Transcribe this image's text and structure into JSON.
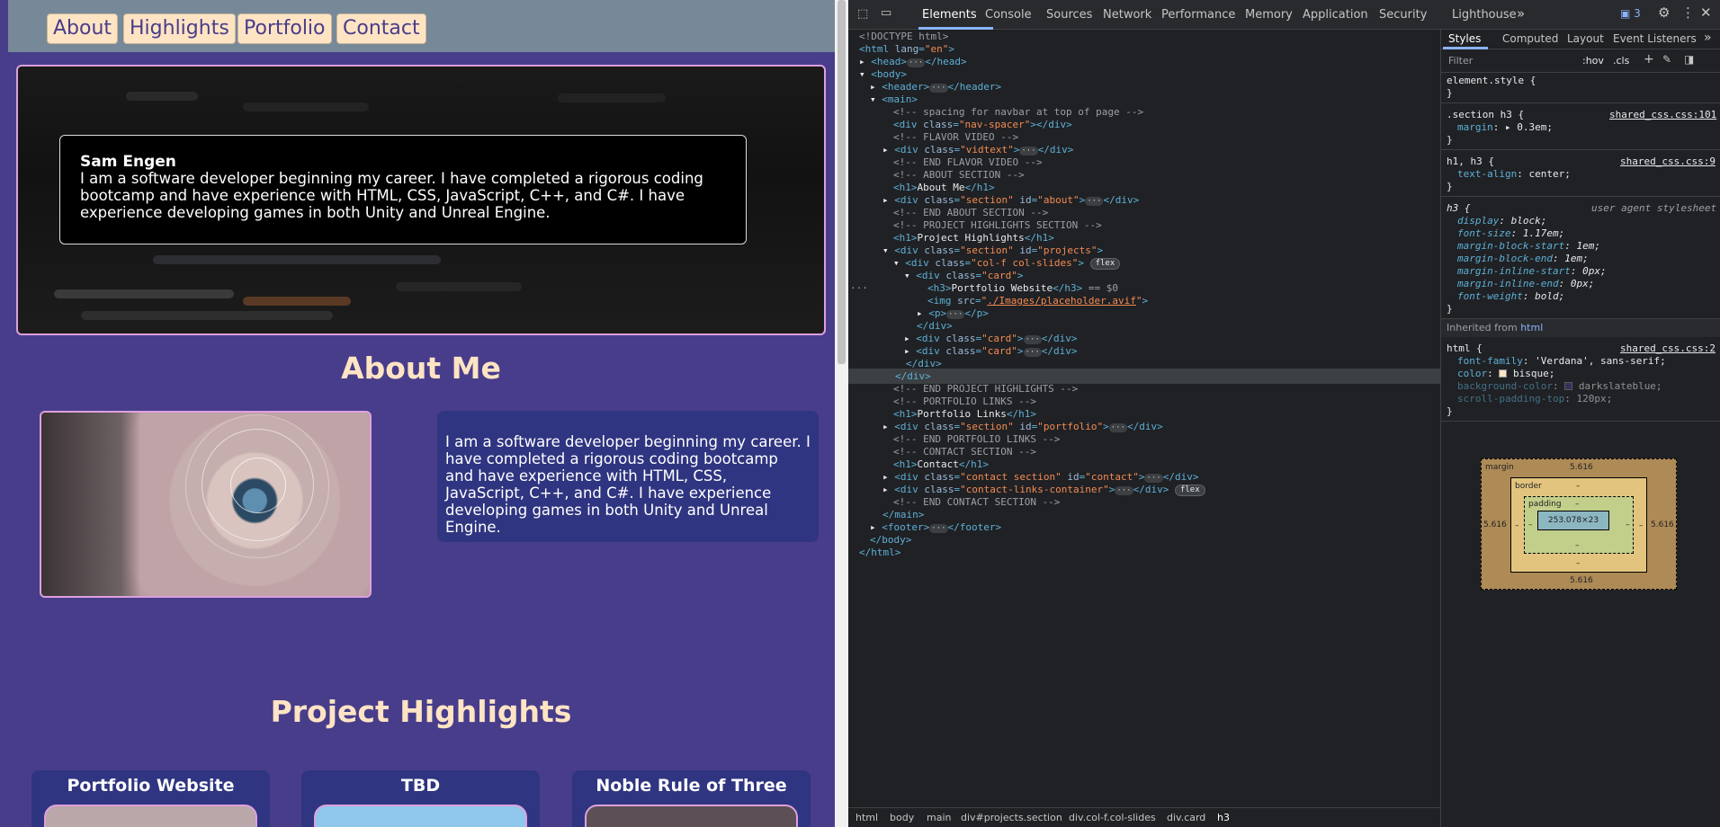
{
  "site": {
    "nav": [
      "About",
      "Highlights",
      "Portfolio",
      "Contact"
    ],
    "hero": {
      "name": "Sam Engen",
      "text": "I am a software developer beginning my career. I have completed a rigorous coding bootcamp and have experience with HTML, CSS, JavaScript, C++, and C#. I have experience developing games in both Unity and Unreal Engine."
    },
    "about_title": "About Me",
    "about_text": "I am a software developer beginning my career. I have completed a rigorous coding bootcamp and have experience with HTML, CSS, JavaScript, C++, and C#. I have experience developing games in both Unity and Unreal Engine.",
    "projects_title": "Project Highlights",
    "cards": [
      "Portfolio Website",
      "TBD",
      "Noble Rule of Three"
    ]
  },
  "devtools": {
    "tabs": [
      "Elements",
      "Console",
      "Sources",
      "Network",
      "Performance",
      "Memory",
      "Application",
      "Security",
      "Lighthouse"
    ],
    "more": "»",
    "issues": "3",
    "selected_marker": "== $0",
    "breadcrumb": [
      "html",
      "body",
      "main",
      "div#projects.section",
      "div.col-f.col-slides",
      "div.card",
      "h3"
    ],
    "styles_tabs": [
      "Styles",
      "Computed",
      "Layout",
      "Event Listeners"
    ],
    "filter_placeholder": "Filter",
    "hov": ":hov",
    "cls": ".cls",
    "inherited_label": "Inherited from",
    "inherited_tag": "html",
    "boxmodel": {
      "margin_label": "margin",
      "margin": "5.616",
      "border_label": "border",
      "border": "–",
      "padding_label": "padding",
      "padding": "–",
      "content": "253.078×23"
    },
    "rules": [
      {
        "sel": "element.style {",
        "src": ""
      },
      {
        "sel": ".section h3 {",
        "src": "shared_css.css:101",
        "prop": "margin",
        "val": "0.3em;"
      },
      {
        "sel": "h1, h3 {",
        "src": "shared_css.css:9",
        "prop": "text-align",
        "val": "center;"
      },
      {
        "sel": "h3 {",
        "src": "user agent stylesheet"
      },
      {
        "sel": "html {",
        "src": "shared_css.css:2"
      }
    ]
  }
}
